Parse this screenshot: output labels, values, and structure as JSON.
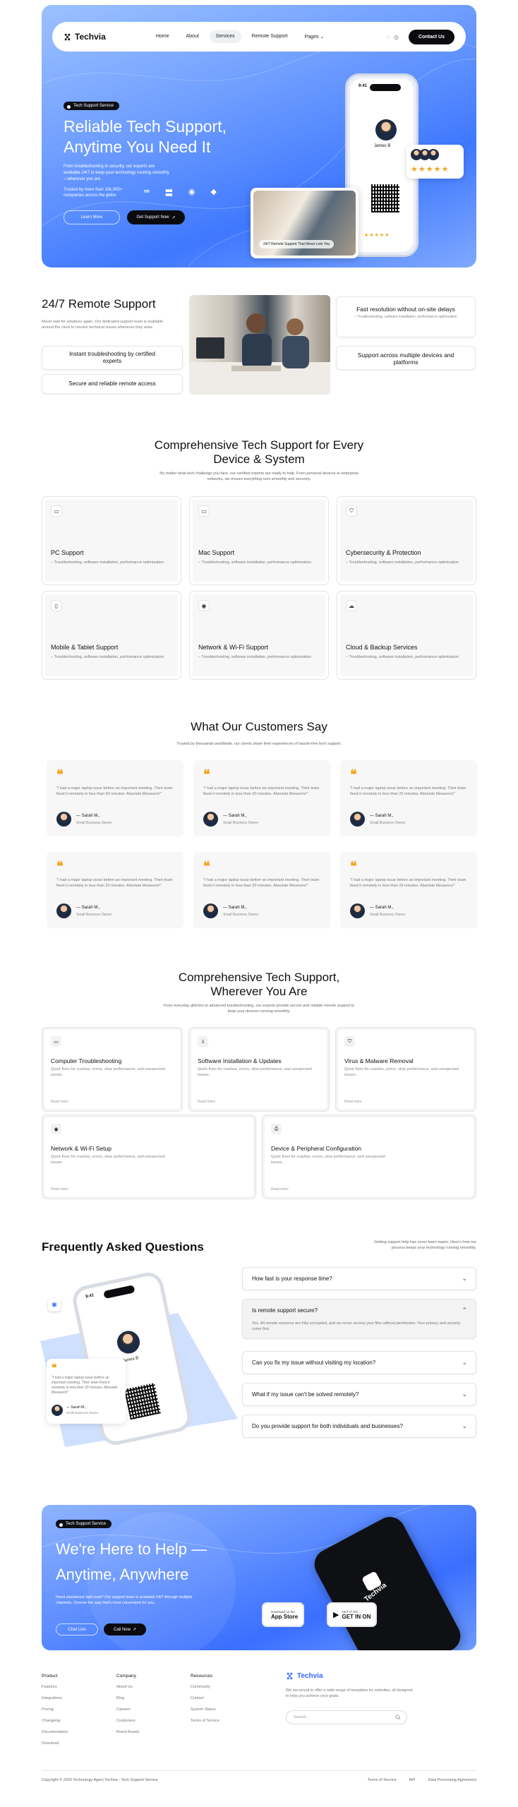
{
  "nav": {
    "brand": "Techvia",
    "links": [
      "Home",
      "About",
      "Services",
      "Remote Support",
      "Pages"
    ],
    "cta": "Contact Us"
  },
  "hero": {
    "badge": "Tech Support Service",
    "title": "Reliable Tech Support, Anytime You Need It",
    "subtitle": "From troubleshooting to security, our experts are available 24/7 to keep your technology running smoothly—wherever you are.",
    "trust": "Trusted by more than 10k,000+ companies across the globe",
    "btn_secondary": "Learn More",
    "btn_primary": "Get Support Now",
    "phone_time": "9:41",
    "agent_name": "James B",
    "photo_caption": "24/7 Remote Support That Never Lets You"
  },
  "remote": {
    "title": "24/7 Remote Support",
    "desc": "Never wait for solutions again. Our dedicated support team is available around the clock to resolve technical issues whenever they arise.",
    "pill1": "Instant troubleshooting by certified experts",
    "pill2": "Secure and reliable remote access",
    "card1_title": "Fast resolution without on-site delays",
    "card1_desc": "– Troubleshooting, software installation, performance optimization",
    "card2_title": "Support across multiple devices and platforms"
  },
  "services": {
    "title": "Comprehensive Tech Support for Every Device & System",
    "subtitle": "No matter what tech challenge you face, our certified experts are ready to help. From personal devices to enterprise networks, we ensure everything runs smoothly and securely.",
    "items": [
      {
        "title": "PC Support",
        "desc": "– Troubleshooting, software installation, performance optimization"
      },
      {
        "title": "Mac Support",
        "desc": "– Troubleshooting, software installation, performance optimization"
      },
      {
        "title": "Cybersecurity & Protection",
        "desc": "– Troubleshooting, software installation, performance optimization"
      },
      {
        "title": "Mobile & Tablet Support",
        "desc": "– Troubleshooting, software installation, performance optimization"
      },
      {
        "title": "Network & Wi-Fi Support",
        "desc": "– Troubleshooting, software installation, performance optimization"
      },
      {
        "title": "Cloud & Backup Services",
        "desc": "– Troubleshooting, software installation, performance optimization"
      }
    ]
  },
  "testimonials": {
    "title": "What Our Customers Say",
    "subtitle": "Trusted by thousands worldwide, our clients share their experiences of hassle-free tech support.",
    "quote": "\"I had a major laptop issue before an important meeting. Their team fixed it remotely in less than 20 minutes. Absolute lifesavers!\"",
    "name": "— Sarah M.,",
    "role": "Small Business Owner"
  },
  "help": {
    "title": "Comprehensive Tech Support, Wherever You Are",
    "subtitle": "From everyday glitches to advanced troubleshooting, our experts provide secure and reliable remote support to keep your devices running smoothly.",
    "desc": "Quick fixes for crashes, errors, slow performance, and unexpected issues.",
    "read_more": "Read more",
    "items": [
      "Computer Troubleshooting",
      "Software Installation & Updates",
      "Virus & Malware Removal",
      "Network & Wi-Fi Setup",
      "Device & Peripheral Configuration"
    ]
  },
  "faq": {
    "title": "Frequently Asked Questions",
    "side": "Getting support help has never been easier. Here's how our process keeps your technology running smoothly.",
    "items": [
      "How fast is your response time?",
      "Is remote support secure?",
      "Can you fix my issue without visiting my location?",
      "What if my issue can't be solved remotely?",
      "Do you provide support for both individuals and businesses?"
    ],
    "open_answer": "Yes. All remote sessions are fully encrypted, and we never access your files without permission. Your privacy and security come first.",
    "art_time": "9:41",
    "art_name": "James B",
    "art_quote": "\"I had a major laptop issue before an important meeting. Their team fixed it remotely in less than 20 minutes. Absolute lifesavers!\"",
    "art_person": "— Sarah M.,",
    "art_role": "Small Business Owner"
  },
  "cta": {
    "badge": "Tech Support Service",
    "title": "We're Here to Help — Anytime, Anywhere",
    "subtitle": "Need assistance right now? Our support team is available 24/7 through multiple channels. Choose the way that's most convenient for you.",
    "btn1": "Chat Live",
    "btn2": "Call Now",
    "appstore_small": "Download on the",
    "appstore_big": "App Store",
    "gplay_small": "GET IT ON",
    "gplay_big": "GET IN ON",
    "phone_brand": "Techvia"
  },
  "footer": {
    "columns": [
      {
        "heading": "Product",
        "items": [
          "Features",
          "Integrations",
          "Pricing",
          "Changelog",
          "Documentation",
          "Download"
        ]
      },
      {
        "heading": "Company",
        "items": [
          "About Us",
          "Blog",
          "Careers",
          "Customers",
          "Brand Assets"
        ]
      },
      {
        "heading": "Resources",
        "items": [
          "Community",
          "Contact",
          "System Status",
          "Terms of Service"
        ]
      }
    ],
    "brand": "Techvia",
    "desc": "We are proud to offer a wide range of templates for websites, all designed to help you achieve your goals.",
    "search_placeholder": "Search...",
    "copyright": "Copyright © 2025 Technology Agen| Techvia - Tech Support Service",
    "legal": [
      "Terms of Service",
      "API",
      "Data Processing Agreement"
    ]
  },
  "colors": {
    "accent": "#3f78ff",
    "dark": "#0b0b0f",
    "star": "#f5a623"
  }
}
